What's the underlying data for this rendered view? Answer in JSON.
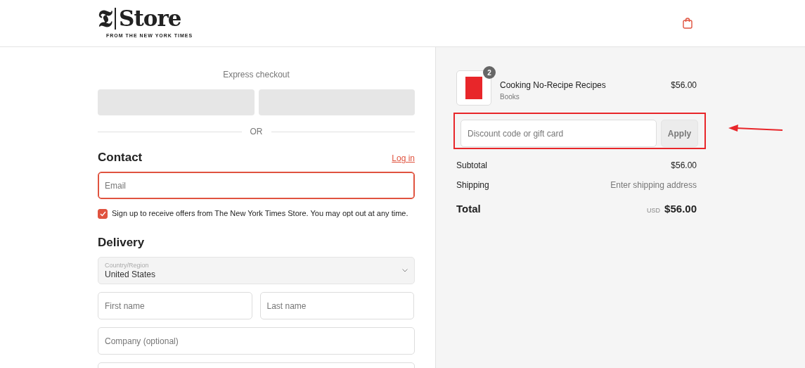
{
  "header": {
    "logo_mark": "𝕿",
    "logo_word": "Store",
    "tagline": "FROM THE NEW YORK TIMES"
  },
  "checkout": {
    "express_label": "Express checkout",
    "divider": "OR",
    "contact": {
      "heading": "Contact",
      "login": "Log in",
      "email": {
        "placeholder": "Email",
        "focused": true
      },
      "newsletter": {
        "label": "Sign up to receive offers from The New York Times Store. You may opt out at any time.",
        "checked": true
      }
    },
    "delivery": {
      "heading": "Delivery",
      "country": {
        "label": "Country/Region",
        "value": "United States"
      },
      "fields": [
        {
          "placeholder": "First name",
          "half": true
        },
        {
          "placeholder": "Last name",
          "half": true
        },
        {
          "placeholder": "Company (optional)",
          "half": false
        },
        {
          "half": false
        }
      ]
    }
  },
  "summary": {
    "items": [
      {
        "name": "Cooking No-Recipe Recipes",
        "category": "Books",
        "price": "$56.00",
        "quantity": "2"
      }
    ],
    "discount": {
      "placeholder": "Discount code or gift card",
      "button": "Apply"
    },
    "lines": [
      {
        "label": "Subtotal",
        "value": "$56.00",
        "muted": false
      },
      {
        "label": "Shipping",
        "value": "Enter shipping address",
        "muted": true
      }
    ],
    "total": {
      "label": "Total",
      "currency": "USD",
      "value": "$56.00"
    }
  }
}
